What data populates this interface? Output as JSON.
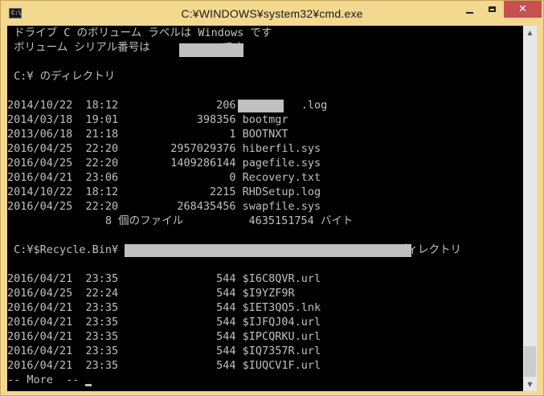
{
  "window": {
    "title": "C:¥WINDOWS¥system32¥cmd.exe",
    "icon_label": "C:\\",
    "buttons": {
      "minimize": "minimize",
      "maximize": "maximize",
      "close": "✕"
    }
  },
  "console": {
    "lines": [
      " ドライブ C のボリューム ラベルは Windows です",
      " ボリューム シリアル番号は           です",
      "",
      " C:¥ のディレクトリ",
      "",
      "2014/10/22  18:12               206          .log",
      "2014/03/18  19:01            398356 bootmgr",
      "2013/06/18  21:18                 1 BOOTNXT",
      "2016/04/25  22:20        2957029376 hiberfil.sys",
      "2016/04/25  22:20        1409286144 pagefile.sys",
      "2016/04/21  23:06                 0 Recovery.txt",
      "2014/10/22  18:12              2215 RHDSetup.log",
      "2016/04/25  22:20         268435456 swapfile.sys",
      "               8 個のファイル          4635151754 バイト",
      "",
      " C:¥$Recycle.Bin¥                                         のディレクトリ",
      "",
      "2016/04/21  23:35               544 $I6C8QVR.url",
      "2016/04/25  22:24               544 $I9YZF9R",
      "2016/04/21  23:35               544 $IET3QQ5.lnk",
      "2016/04/21  23:35               544 $IJFQJ04.url",
      "2016/04/21  23:35               544 $IPCQRKU.url",
      "2016/04/21  23:35               544 $IQ7357R.url",
      "2016/04/21  23:35               544 $IUQCV1F.url",
      "-- More  --"
    ]
  },
  "colors": {
    "console_bg": "#000000",
    "console_fg": "#c0c0c0",
    "title_bar": "#f3d98f",
    "close_button": "#c75050"
  }
}
